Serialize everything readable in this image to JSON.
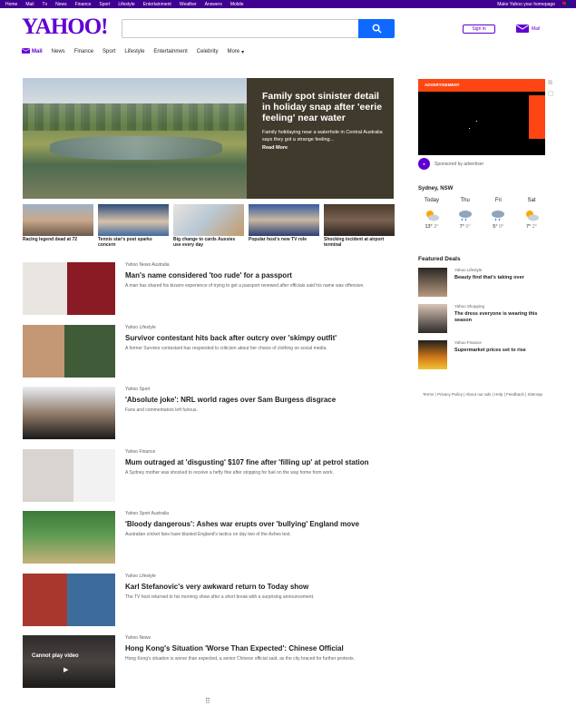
{
  "topbar": {
    "links": [
      "Home",
      "Mail",
      "Tv",
      "News",
      "Finance",
      "Sport",
      "Lifestyle",
      "Entertainment",
      "Weather",
      "Answers",
      "Mobile"
    ],
    "right_label": "Make Yahoo your homepage"
  },
  "header": {
    "logo": "YAHOO!",
    "search_placeholder": "",
    "signin_label": "Sign in",
    "mail_label": "Mail"
  },
  "nav": {
    "items": [
      "Mail",
      "News",
      "Finance",
      "Sport",
      "Lifestyle",
      "Entertainment",
      "Celebrity",
      "More"
    ]
  },
  "hero": {
    "title": "Family spot sinister detail in holiday snap after 'eerie feeling' near water",
    "summary": "Family holidaying near a waterhole in Central Australia says they got a strange feeling...",
    "more": "Read More"
  },
  "thumbs": [
    {
      "caption": "Racing legend dead at 72"
    },
    {
      "caption": "Tennis star's post sparks concern"
    },
    {
      "caption": "Big change to cards Aussies use every day"
    },
    {
      "caption": "Popular host's new TV role"
    },
    {
      "caption": "Shocking incident at airport terminal"
    }
  ],
  "stream": [
    {
      "provider": "Yahoo News Australia",
      "title": "Man's name considered 'too rude' for a passport",
      "summary": "A man has shared his bizarre experience of trying to get a passport renewed after officials said his name was offensive."
    },
    {
      "provider": "Yahoo Lifestyle",
      "title": "Survivor contestant hits back after outcry over 'skimpy outfit'",
      "summary": "A former Survivor contestant has responded to criticism about her choice of clothing on social media."
    },
    {
      "provider": "Yahoo Sport",
      "title": "'Absolute joke': NRL world rages over Sam Burgess disgrace",
      "summary": "Fans and commentators left furious."
    },
    {
      "provider": "Yahoo Finance",
      "title": "Mum outraged at 'disgusting' $107 fine after 'filling up' at petrol station",
      "summary": "A Sydney mother was shocked to receive a hefty fine after stopping for fuel on the way home from work."
    },
    {
      "provider": "Yahoo Sport Australia",
      "title": "'Bloody dangerous': Ashes war erupts over 'bullying' England move",
      "summary": "Australian cricket fans have blasted England's tactics on day two of the Ashes test."
    },
    {
      "provider": "Yahoo Lifestyle",
      "title": "Karl Stefanovic's very awkward return to Today show",
      "summary": "The TV host returned to his morning show after a short break with a surprising announcement."
    },
    {
      "provider": "Yahoo News",
      "title": "Hong Kong's Situation 'Worse Than Expected': Chinese Official",
      "summary": "Hong Kong's situation is worse than expected, a senior Chinese official said, as the city braced for further protests."
    }
  ],
  "video_overlay": "Cannot play video",
  "rail": {
    "ad_label": "ADVERTISEMENT",
    "sponsor_text": "Sponsored by advertiser",
    "weather_location": "Sydney, NSW",
    "weather_days": [
      {
        "day": "Today",
        "hi": "13°",
        "lo": "3°"
      },
      {
        "day": "Thu",
        "hi": "7°",
        "lo": "0°"
      },
      {
        "day": "Fri",
        "hi": "5°",
        "lo": "0°"
      },
      {
        "day": "Sat",
        "hi": "7°",
        "lo": "2°"
      }
    ],
    "featured_title": "Featured Deals",
    "featured": [
      {
        "provider": "Yahoo Lifestyle",
        "title": "Beauty find that's taking over"
      },
      {
        "provider": "Yahoo Shopping",
        "title": "The dress everyone is wearing this season"
      },
      {
        "provider": "Yahoo Finance",
        "title": "Supermarket prices set to rise"
      }
    ],
    "footer": "Terms | Privacy Policy | About our ads | Help | Feedback | Sitemap"
  }
}
